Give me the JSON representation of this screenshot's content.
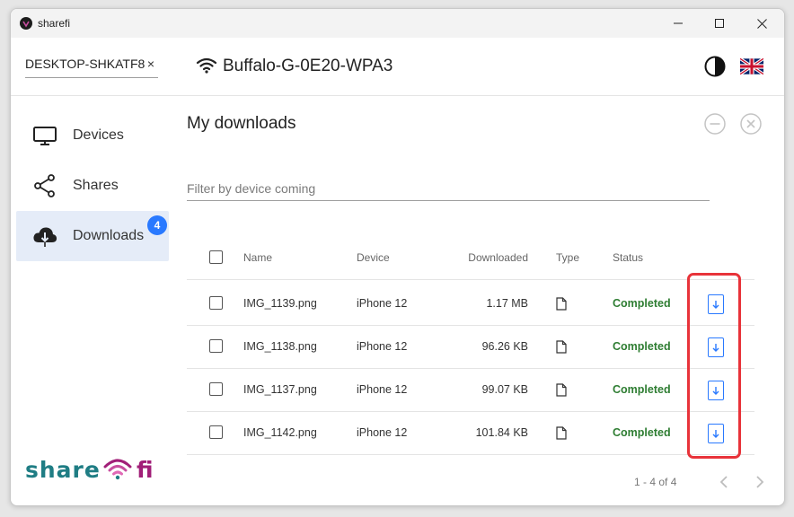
{
  "window": {
    "title": "sharefi"
  },
  "header": {
    "device_chip": "DESKTOP-SHKATF8",
    "device_chip_close": "×",
    "network_name": "Buffalo-G-0E20-WPA3"
  },
  "sidebar": {
    "items": [
      {
        "label": "Devices",
        "icon": "monitor-icon"
      },
      {
        "label": "Shares",
        "icon": "share-icon"
      },
      {
        "label": "Downloads",
        "icon": "cloud-download-icon",
        "badge": "4",
        "active": true
      }
    ],
    "logo_text": "sharefi"
  },
  "main": {
    "title": "My downloads",
    "filter_placeholder": "Filter by device coming",
    "columns": [
      "Name",
      "Device",
      "Downloaded",
      "Type",
      "Status"
    ],
    "rows": [
      {
        "name": "IMG_1139.png",
        "device": "iPhone 12",
        "downloaded": "1.17 MB",
        "status": "Completed"
      },
      {
        "name": "IMG_1138.png",
        "device": "iPhone 12",
        "downloaded": "96.26 KB",
        "status": "Completed"
      },
      {
        "name": "IMG_1137.png",
        "device": "iPhone 12",
        "downloaded": "99.07 KB",
        "status": "Completed"
      },
      {
        "name": "IMG_1142.png",
        "device": "iPhone 12",
        "downloaded": "101.84 KB",
        "status": "Completed"
      }
    ],
    "pagination": "1 - 4 of 4"
  },
  "colors": {
    "accent": "#2979ff",
    "completed": "#2e7d32",
    "highlight": "#e8333a",
    "logo_dark": "#1f7d84",
    "logo_wifi": "#a11f78"
  }
}
